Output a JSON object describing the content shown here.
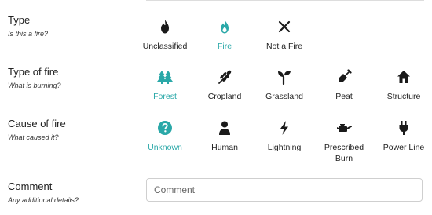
{
  "colors": {
    "accent": "#2aa8a8",
    "text": "#222222",
    "icon": "#1a1a1a"
  },
  "type": {
    "title": "Type",
    "subtitle": "Is this a fire?",
    "options": [
      {
        "label": "Unclassified",
        "icon": "flame-icon",
        "selected": false
      },
      {
        "label": "Fire",
        "icon": "flame-icon",
        "selected": true
      },
      {
        "label": "Not a Fire",
        "icon": "close-icon",
        "selected": false
      }
    ]
  },
  "type_of_fire": {
    "title": "Type of fire",
    "subtitle": "What is burning?",
    "options": [
      {
        "label": "Forest",
        "icon": "trees-icon",
        "selected": true
      },
      {
        "label": "Cropland",
        "icon": "wheat-icon",
        "selected": false
      },
      {
        "label": "Grassland",
        "icon": "seedling-icon",
        "selected": false
      },
      {
        "label": "Peat",
        "icon": "shovel-icon",
        "selected": false
      },
      {
        "label": "Structure",
        "icon": "house-icon",
        "selected": false
      }
    ]
  },
  "cause_of_fire": {
    "title": "Cause of fire",
    "subtitle": "What caused it?",
    "options": [
      {
        "label": "Unknown",
        "icon": "question-circle-icon",
        "selected": true
      },
      {
        "label": "Human",
        "icon": "person-icon",
        "selected": false
      },
      {
        "label": "Lightning",
        "icon": "bolt-icon",
        "selected": false
      },
      {
        "label": "Prescribed Burn",
        "icon": "oil-can-icon",
        "selected": false
      },
      {
        "label": "Power Line",
        "icon": "plug-icon",
        "selected": false
      }
    ]
  },
  "comment": {
    "title": "Comment",
    "subtitle": "Any additional details?",
    "placeholder": "Comment",
    "value": ""
  }
}
